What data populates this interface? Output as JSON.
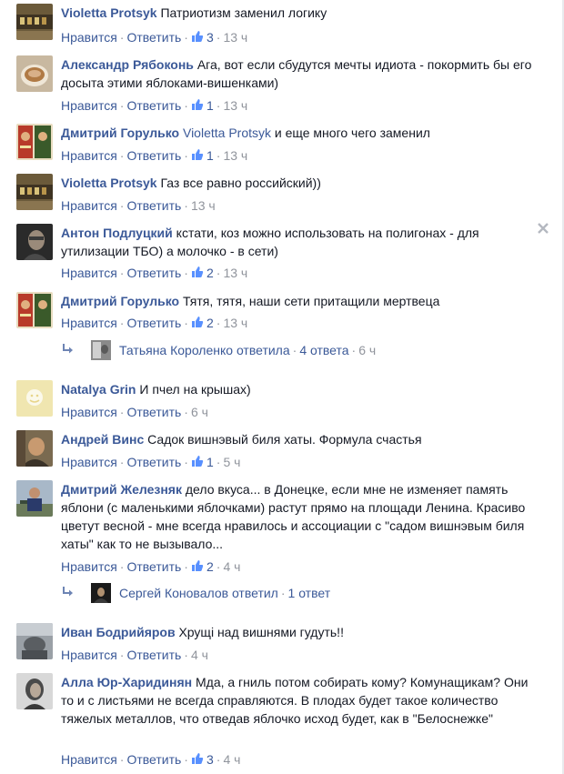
{
  "ui": {
    "like": "Нравится",
    "reply": "Ответить",
    "separator": "·"
  },
  "comments": [
    {
      "author": "Violetta Protsyk",
      "text": "Патриотизм заменил логику",
      "likes": "3",
      "time": "13 ч"
    },
    {
      "author": "Александр Рябоконь",
      "text": "Ага, вот если сбудутся мечты идиота - покормить бы его досыта этими яблоками-вишенками)",
      "likes": "1",
      "time": "13 ч"
    },
    {
      "author": "Дмитрий Горулько",
      "mention": "Violetta Protsyk",
      "text": "и еще много чего заменил",
      "likes": "1",
      "time": "13 ч"
    },
    {
      "author": "Violetta Protsyk",
      "text": "Газ все равно российский))",
      "likes": "",
      "time": "13 ч"
    },
    {
      "author": "Антон Подлуцкий",
      "text": "кстати, коз можно использовать на полигонах - для утилизации ТБО) а молочко - в сети)",
      "likes": "2",
      "time": "13 ч"
    },
    {
      "author": "Дмитрий Горулько",
      "text": "Тятя, тятя, наши сети притащили мертвеца",
      "likes": "2",
      "time": "13 ч",
      "replies": {
        "name": "Татьяна Короленко",
        "verb": "ответила",
        "count": "4 ответа",
        "time": "6 ч"
      }
    },
    {
      "author": "Natalya Grin",
      "text": "И пчел на крышах)",
      "likes": "",
      "time": "6 ч"
    },
    {
      "author": "Андрей Винс",
      "text": "Садок вишнэвый биля хаты. Формула счастья",
      "likes": "1",
      "time": "5 ч"
    },
    {
      "author": "Дмитрий Железняк",
      "text": "дело вкуса... в Донецке, если мне не изменяет память яблони (с маленькими яблочками) растут прямо на площади Ленина. Красиво цветут весной - мне всегда нравилось и ассоциации с \"садом вишнэвым биля хаты\" как то не вызывало...",
      "likes": "2",
      "time": "4 ч",
      "replies": {
        "name": "Сергей Коновалов",
        "verb": "ответил",
        "count": "1 ответ",
        "time": ""
      }
    },
    {
      "author": "Иван Бодрийяров",
      "text": "Хрущі над вишнями гудуть!!",
      "likes": "",
      "time": "4 ч"
    },
    {
      "author": "Алла Юр-Харидинян",
      "text": "Мда, а гниль потом собирать кому? Комунащикам? Они то и с листьями не всегда справляются. В плодах будет такое количество тяжелых металлов, что отведав яблочко исход будет, как в \"Белоснежке\"",
      "likes": "3",
      "time": "4 ч"
    }
  ]
}
